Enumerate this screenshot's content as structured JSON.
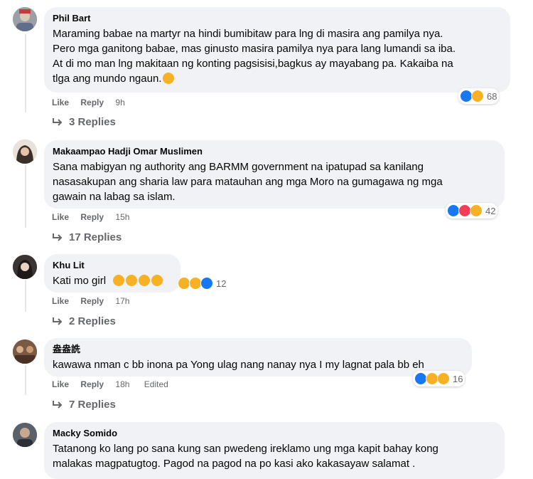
{
  "comments": [
    {
      "author": "Phil Bart",
      "lines": [
        "Maraming babae na martyr na hindi bumibitaw para lng di masira ang pamilya nya.",
        "Pero mga ganitong babae, mas ginusto masira pamilya nya para lang lumandi sa iba.",
        "At di mo man lng makitaan ng konting pagsisisi,bagkus ay mayabang pa. Kakaiba na",
        "tlga ang mundo ngaun."
      ],
      "trailing_emoji": "sad-face-emoji",
      "actions": {
        "like": "Like",
        "reply": "Reply",
        "time": "9h"
      },
      "reactions": {
        "icons": [
          "like",
          "sad"
        ],
        "count": "68"
      },
      "replies": "3 Replies"
    },
    {
      "author": "Makaampao Hadji Omar Muslimen",
      "lines": [
        "Sana mabigyan ng authority ang BARMM government na ipatupad sa kanilang",
        "nasasakupan ang sharia law para matauhan ang mga Moro na gumagawa ng mga",
        "gawain na labag sa islam."
      ],
      "actions": {
        "like": "Like",
        "reply": "Reply",
        "time": "15h"
      },
      "reactions": {
        "icons": [
          "like",
          "love",
          "care"
        ],
        "count": "42"
      },
      "replies": "17 Replies"
    },
    {
      "author": "Khu Lit",
      "lines": [
        "Kati mo girl"
      ],
      "trailing_emoji": "laughing-emoji x4",
      "actions": {
        "like": "Like",
        "reply": "Reply",
        "time": "17h"
      },
      "reactions": {
        "icons": [
          "haha",
          "wow",
          "like"
        ],
        "count": "12"
      },
      "replies": "2 Replies"
    },
    {
      "author": "盎盎詵",
      "lines": [
        "kawawa nman c bb inona pa Yong ulag nang nanay nya I my lagnat pala bb eh"
      ],
      "actions": {
        "like": "Like",
        "reply": "Reply",
        "time": "18h",
        "edited": "Edited"
      },
      "reactions": {
        "icons": [
          "like",
          "sad",
          "care"
        ],
        "count": "16"
      },
      "replies": "7 Replies"
    },
    {
      "author": "Macky Somido",
      "lines": [
        "Tatanong ko lang po sana kung san pwedeng ireklamo ung mga kapit bahay kong",
        "malakas magpatugtog. Pagod na pagod na po kasi ako kakasayaw salamat ."
      ]
    }
  ],
  "colors": {
    "bubble": "#f0f2f5",
    "text": "#050505",
    "meta": "#65676b",
    "like_blue": "#1877f2",
    "love_red": "#f33e58",
    "emoji_yellow": "#f7b125"
  }
}
